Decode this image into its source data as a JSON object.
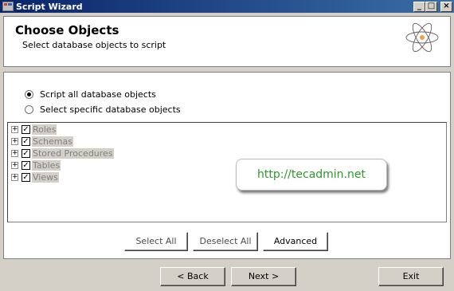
{
  "window": {
    "title": "Script Wizard",
    "controls": {
      "minimize": "_",
      "maximize": "□",
      "close": "×"
    }
  },
  "header": {
    "title": "Choose Objects",
    "subtitle": "Select database objects to script",
    "logo_icon": "atom-icon"
  },
  "options": [
    {
      "label": "Script all database objects",
      "selected": true
    },
    {
      "label": "Select specific database objects",
      "selected": false
    }
  ],
  "tree": {
    "items": [
      {
        "label": "Roles",
        "checked": true,
        "expander": "+"
      },
      {
        "label": "Schemas",
        "checked": true,
        "expander": "+"
      },
      {
        "label": "Stored Procedures",
        "checked": true,
        "expander": "+"
      },
      {
        "label": "Tables",
        "checked": true,
        "expander": "+"
      },
      {
        "label": "Views",
        "checked": true,
        "expander": "+"
      }
    ]
  },
  "watermark": {
    "text": "http://tecadmin.net",
    "color": "#2b9a2b"
  },
  "selection_buttons": {
    "select_all": "Select All",
    "deselect_all": "Deselect All",
    "advanced": "Advanced"
  },
  "footer": {
    "back": "< Back",
    "next": "Next >",
    "exit": "Exit"
  }
}
